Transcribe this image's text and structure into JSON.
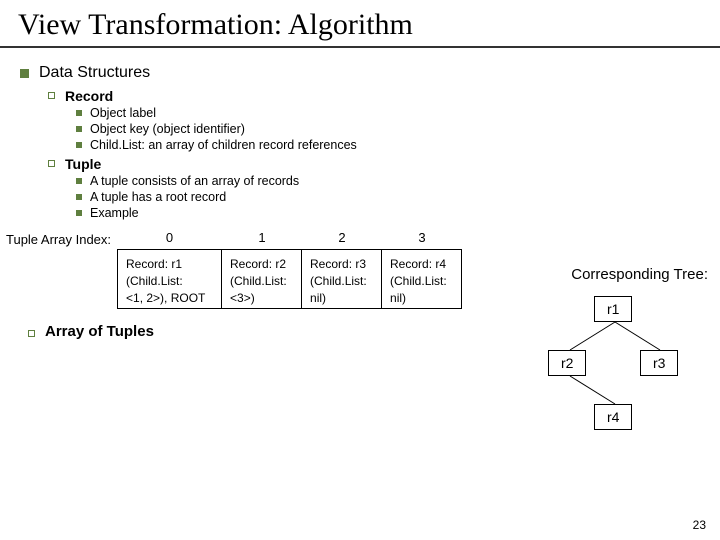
{
  "title": "View Transformation: Algorithm",
  "sections": {
    "data_structures": "Data Structures",
    "record": {
      "label": "Record",
      "items": [
        "Object label",
        "Object key (object identifier)",
        "Child.List: an array of children record references"
      ]
    },
    "tuple": {
      "label": "Tuple",
      "items": [
        "A tuple consists of an array of records",
        "A tuple has a root record",
        "Example"
      ]
    },
    "array_of_tuples": "Array of Tuples"
  },
  "tuple_array": {
    "label": "Tuple Array Index:",
    "indices": [
      "0",
      "1",
      "2",
      "3"
    ],
    "cells": [
      {
        "l1": "Record: r1",
        "l2": "(Child.List:",
        "l3": "<1, 2>), ROOT"
      },
      {
        "l1": "Record: r2",
        "l2": "(Child.List:",
        "l3": "<3>)"
      },
      {
        "l1": "Record: r3",
        "l2": "(Child.List:",
        "l3": "nil)"
      },
      {
        "l1": "Record: r4",
        "l2": "(Child.List:",
        "l3": "nil)"
      }
    ]
  },
  "tree": {
    "label": "Corresponding Tree:",
    "nodes": {
      "r1": "r1",
      "r2": "r2",
      "r3": "r3",
      "r4": "r4"
    }
  },
  "page_number": "23"
}
